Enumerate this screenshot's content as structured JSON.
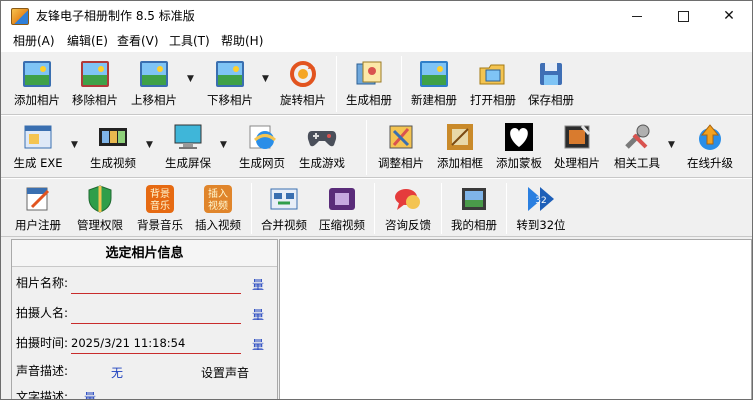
{
  "window": {
    "title": "友锋电子相册制作 8.5 标准版",
    "minimize_label": "",
    "maximize_label": "",
    "close_label": "✕"
  },
  "menu": [
    "相册(A)",
    "编辑(E)",
    "查看(V)",
    "工具(T)",
    "帮助(H)"
  ],
  "toolbar1": [
    {
      "label": "添加相片",
      "icon": "add-photo-icon"
    },
    {
      "label": "移除相片",
      "icon": "remove-photo-icon"
    },
    {
      "label": "上移相片",
      "icon": "move-up-photo-icon"
    },
    {
      "label": "下移相片",
      "icon": "move-down-photo-icon"
    },
    {
      "label": "旋转相片",
      "icon": "rotate-photo-icon"
    },
    {
      "label": "生成相册",
      "icon": "generate-album-icon"
    },
    {
      "label": "新建相册",
      "icon": "new-album-icon"
    },
    {
      "label": "打开相册",
      "icon": "open-album-icon"
    },
    {
      "label": "保存相册",
      "icon": "save-album-icon"
    }
  ],
  "toolbar2": [
    {
      "label": "生成 EXE",
      "icon": "exe-icon"
    },
    {
      "label": "生成视频",
      "icon": "video-film-icon"
    },
    {
      "label": "生成屏保",
      "icon": "screensaver-icon"
    },
    {
      "label": "生成网页",
      "icon": "webpage-icon"
    },
    {
      "label": "生成游戏",
      "icon": "gamepad-icon"
    },
    {
      "label": "调整相片",
      "icon": "adjust-photo-icon"
    },
    {
      "label": "添加相框",
      "icon": "add-frame-icon"
    },
    {
      "label": "添加蒙板",
      "icon": "add-mask-icon"
    },
    {
      "label": "处理相片",
      "icon": "process-photo-icon"
    },
    {
      "label": "相关工具",
      "icon": "tools-icon"
    },
    {
      "label": "在线升级",
      "icon": "online-upgrade-icon"
    }
  ],
  "toolbar3": [
    {
      "label": "用户注册",
      "icon": "register-icon"
    },
    {
      "label": "管理权限",
      "icon": "shield-icon"
    },
    {
      "label": "背景音乐",
      "icon": "background-music-icon"
    },
    {
      "label": "插入视频",
      "icon": "insert-video-icon"
    },
    {
      "label": "合并视频",
      "icon": "merge-video-icon"
    },
    {
      "label": "压缩视频",
      "icon": "compress-video-icon"
    },
    {
      "label": "咨询反馈",
      "icon": "feedback-icon"
    },
    {
      "label": "我的相册",
      "icon": "my-album-icon"
    },
    {
      "label": "转到32位",
      "icon": "switch-32bit-icon"
    }
  ],
  "panel": {
    "title": "选定相片信息",
    "fields": [
      {
        "label": "相片名称:",
        "value": "",
        "edit": "量"
      },
      {
        "label": "拍摄人名:",
        "value": "",
        "edit": "量"
      },
      {
        "label": "拍摄时间:",
        "value": "2025/3/21 11:18:54",
        "edit": "量"
      }
    ],
    "voice": {
      "label": "声音描述:",
      "value": "无",
      "button": "设置声音"
    },
    "text_desc": {
      "label": "文字描述:",
      "edit": "量"
    }
  }
}
